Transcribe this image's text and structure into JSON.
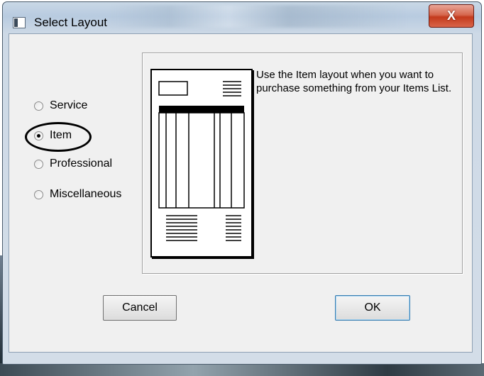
{
  "window": {
    "title": "Select Layout",
    "close_label": "X"
  },
  "layouts": [
    {
      "label": "Service",
      "selected": false
    },
    {
      "label": "Item",
      "selected": true
    },
    {
      "label": "Professional",
      "selected": false
    },
    {
      "label": "Miscellaneous",
      "selected": false
    }
  ],
  "preview": {
    "description": "Use the Item layout when you want to purchase something from your Items List."
  },
  "buttons": {
    "cancel": "Cancel",
    "ok": "OK"
  },
  "colors": {
    "close_button": "#c33a1c",
    "titlebar": "#b8cbe0",
    "client_bg": "#f0f0f0"
  }
}
